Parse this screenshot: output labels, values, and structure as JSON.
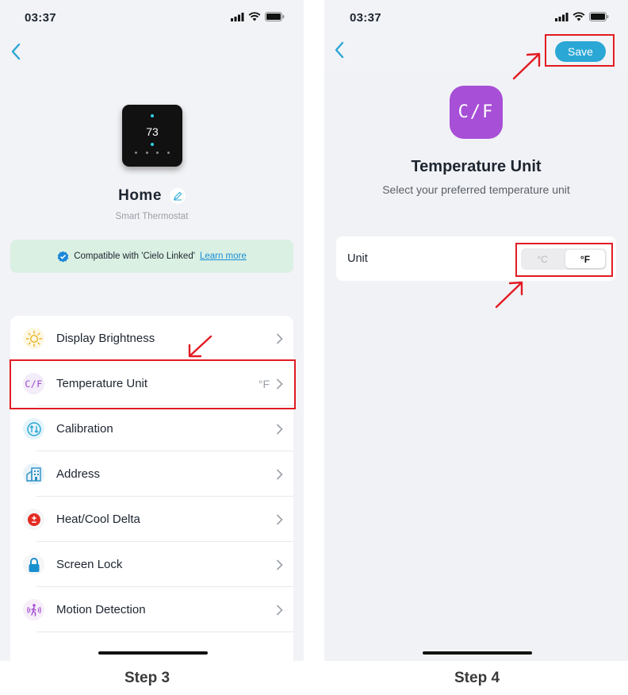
{
  "colors": {
    "accent": "#2aa7d5",
    "highlight": "#e21b23",
    "compat_bg": "#daf0e3",
    "cf_tile": "#a74fd6"
  },
  "step3": {
    "status_time": "03:37",
    "device": {
      "display_temp": "73",
      "name": "Home",
      "subtitle": "Smart Thermostat"
    },
    "compat": {
      "text": "Compatible with 'Cielo Linked'",
      "link": "Learn more"
    },
    "menu": [
      {
        "label": "Display Brightness",
        "value": "",
        "icon": "sun-icon"
      },
      {
        "label": "Temperature Unit",
        "value": "°F",
        "icon": "cf-icon"
      },
      {
        "label": "Calibration",
        "value": "",
        "icon": "calibration-icon"
      },
      {
        "label": "Address",
        "value": "",
        "icon": "building-icon"
      },
      {
        "label": "Heat/Cool Delta",
        "value": "",
        "icon": "plus-minus-icon"
      },
      {
        "label": "Screen Lock",
        "value": "",
        "icon": "lock-icon"
      },
      {
        "label": "Motion Detection",
        "value": "",
        "icon": "motion-icon"
      }
    ],
    "cf_glyph": "C/F",
    "step_label": "Step 3"
  },
  "step4": {
    "status_time": "03:37",
    "save_label": "Save",
    "cf_glyph": "C/F",
    "title": "Temperature Unit",
    "subtitle": "Select your preferred temperature unit",
    "unit_label": "Unit",
    "options": [
      "°C",
      "°F"
    ],
    "selected": "°F",
    "step_label": "Step 4"
  }
}
